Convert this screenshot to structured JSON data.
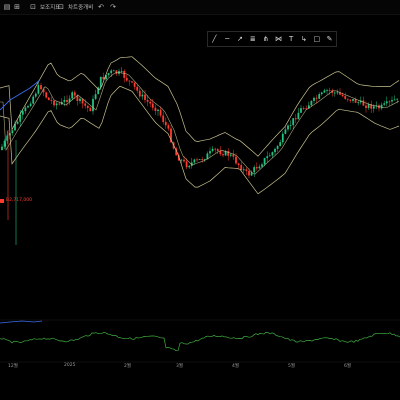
{
  "toolbar": {
    "icons": [
      "chart-icon",
      "grid-icon"
    ],
    "indicator_label": "보조지표",
    "chart_label": "차트중개비",
    "undo_icon": "undo-icon",
    "redo_icon": "redo-icon"
  },
  "drawing_tools": [
    "line-tool-icon",
    "horizontal-line-tool-icon",
    "ray-tool-icon",
    "fib-retracement-icon",
    "pitchfork-icon",
    "fib-fan-icon",
    "text-tool-icon",
    "arrow-tool-icon",
    "rectangle-tool-icon",
    "brush-tool-icon"
  ],
  "price_tag": {
    "label": "B2,717,000",
    "color": "#ff3b30"
  },
  "x_axis_labels": [
    "12월",
    "2025",
    "2월",
    "3월",
    "4월",
    "5월",
    "6월"
  ],
  "colors": {
    "up": "#26c281",
    "down": "#ff3b30",
    "band": "#c9c38f",
    "ma": "#3b6df0",
    "oscillator": "#3fae3f"
  }
}
